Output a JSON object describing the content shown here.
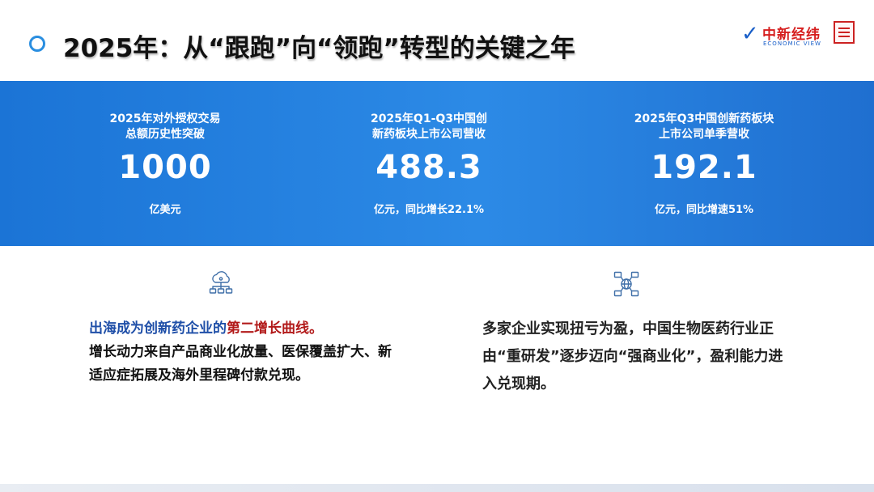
{
  "header": {
    "title": "2025年：从“跟跑”向“领跑”转型的关键之年",
    "logo": {
      "name": "中新经纬",
      "subtitle": "ECONOMIC VIEW"
    }
  },
  "kpis": [
    {
      "label_line1": "2025年对外授权交易",
      "label_line2": "总额历史性突破",
      "value": "1000",
      "unit": "亿美元"
    },
    {
      "label_line1": "2025年Q1-Q3中国创",
      "label_line2": "新药板块上市公司营收",
      "value": "488.3",
      "unit": "亿元，同比增长22.1%"
    },
    {
      "label_line1": "2025年Q3中国创新药板块",
      "label_line2": "上市公司单季营收",
      "value": "192.1",
      "unit": "亿元，同比增速51%"
    }
  ],
  "left_block": {
    "icon": "cloud-network-icon",
    "lead_blue": "出海成为创新药企业的",
    "lead_red": "第二增长曲线。",
    "body": "增长动力来自产品商业化放量、医保覆盖扩大、新适应症拓展及海外里程碑付款兑现。"
  },
  "right_block": {
    "icon": "global-network-icon",
    "body": "多家企业实现扭亏为盈，中国生物医药行业正由“重研发”逐步迈向“强商业化”，盈利能力进入兑现期。"
  },
  "colors": {
    "band": "#2a86e2",
    "accent_blue": "#1f4fa8",
    "accent_red": "#b21a1a",
    "icon": "#3f6fa8"
  }
}
